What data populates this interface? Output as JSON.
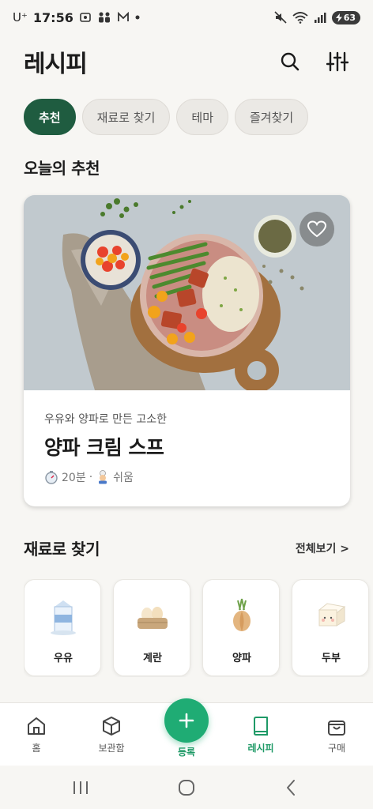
{
  "status_bar": {
    "carrier": "U⁺",
    "time": "17:56",
    "battery": "63"
  },
  "header": {
    "title": "레시피",
    "search_icon": "search-icon",
    "filter_icon": "sliders-icon"
  },
  "tabs": [
    {
      "label": "추천",
      "active": true
    },
    {
      "label": "재료로 찾기",
      "active": false
    },
    {
      "label": "테마",
      "active": false
    },
    {
      "label": "즐겨찾기",
      "active": false
    }
  ],
  "recommend": {
    "section_title": "오늘의 추천",
    "subtitle": "우유와 양파로 만든 고소한",
    "title": "양파 크림 스프",
    "time": "20분",
    "separator": "·",
    "difficulty": "쉬움"
  },
  "ingredients": {
    "section_title": "재료로 찾기",
    "see_all": "전체보기 >",
    "items": [
      {
        "label": "우유",
        "icon": "milk-carton-icon"
      },
      {
        "label": "계란",
        "icon": "eggs-basket-icon"
      },
      {
        "label": "양파",
        "icon": "onion-icon"
      },
      {
        "label": "두부",
        "icon": "tofu-icon"
      }
    ]
  },
  "bottom_nav": {
    "items": [
      {
        "label": "홈",
        "icon": "home-icon"
      },
      {
        "label": "보관함",
        "icon": "box-icon"
      },
      {
        "label": "등록",
        "icon": "plus-icon"
      },
      {
        "label": "레시피",
        "icon": "book-icon",
        "active": true
      },
      {
        "label": "구매",
        "icon": "shopping-bag-icon"
      }
    ]
  },
  "colors": {
    "accent": "#1f5c40",
    "fab": "#1fac74",
    "active_nav": "#1f9a67"
  }
}
